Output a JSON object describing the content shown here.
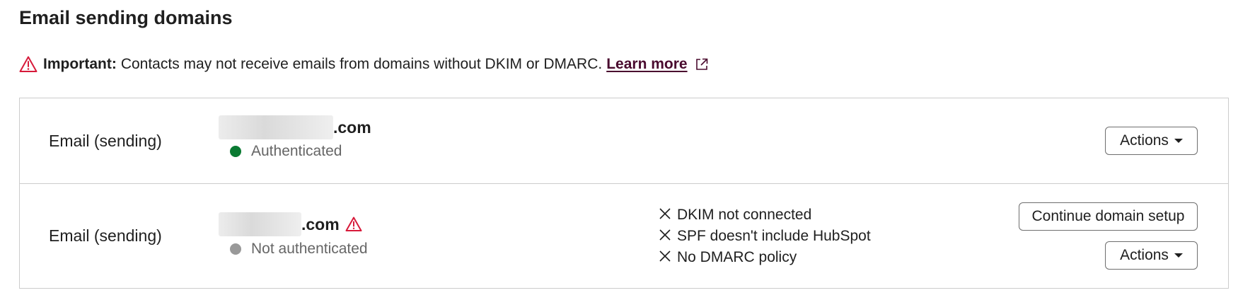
{
  "page": {
    "title": "Email sending domains"
  },
  "notice": {
    "prefix": "Important:",
    "message": "Contacts may not receive emails from domains without DKIM or DMARC.",
    "link_label": "Learn more",
    "warning_icon": "warning-triangle-icon",
    "external_icon": "external-link-icon"
  },
  "domains": [
    {
      "type_label": "Email (sending)",
      "domain_suffix": ".com",
      "status": "Authenticated",
      "status_color": "#0a7a32",
      "actions_label": "Actions"
    },
    {
      "type_label": "Email (sending)",
      "domain_suffix": ".com",
      "status": "Not authenticated",
      "status_color": "#999999",
      "issues": [
        "DKIM not connected",
        "SPF doesn't include HubSpot",
        "No DMARC policy"
      ],
      "setup_label": "Continue domain setup",
      "actions_label": "Actions"
    }
  ],
  "colors": {
    "warning": "#d71a3a",
    "link": "#4a0b2f",
    "border": "#cccccc"
  }
}
